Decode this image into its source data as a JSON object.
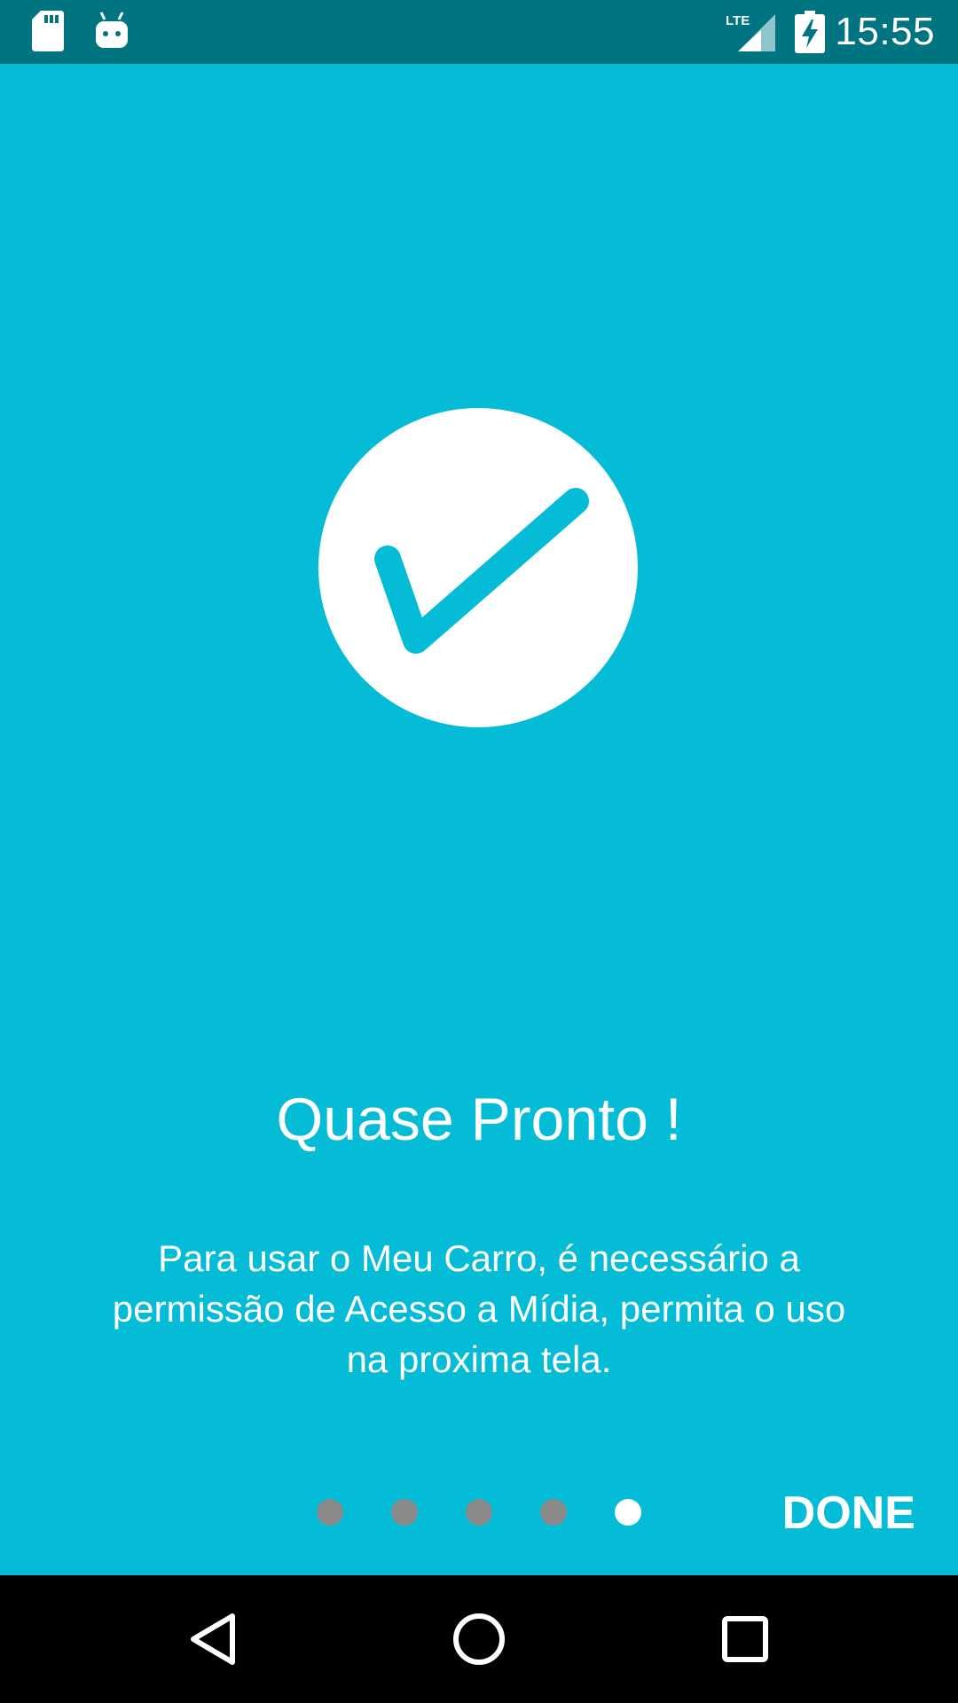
{
  "status_bar": {
    "time": "15:55",
    "network_label": "LTE",
    "icons": [
      "sd-card-icon",
      "android-debug-icon",
      "lte-signal-icon",
      "battery-charging-icon"
    ]
  },
  "onboarding": {
    "title": "Quase Pronto !",
    "description": "Para usar o Meu Carro, é necessário a permissão de Acesso a Mídia, permita o uso na proxima tela.",
    "badge_icon": "checkmark-icon",
    "pager": {
      "total": 5,
      "active_index": 5
    },
    "done_label": "DONE"
  },
  "nav_bar": {
    "icons": [
      "back-icon",
      "home-icon",
      "recents-icon"
    ]
  },
  "colors": {
    "background": "#04BCD6",
    "status_bar": "#017482",
    "dot_inactive": "#8a8a8a",
    "dot_active": "#ffffff",
    "nav_bar": "#000000"
  }
}
